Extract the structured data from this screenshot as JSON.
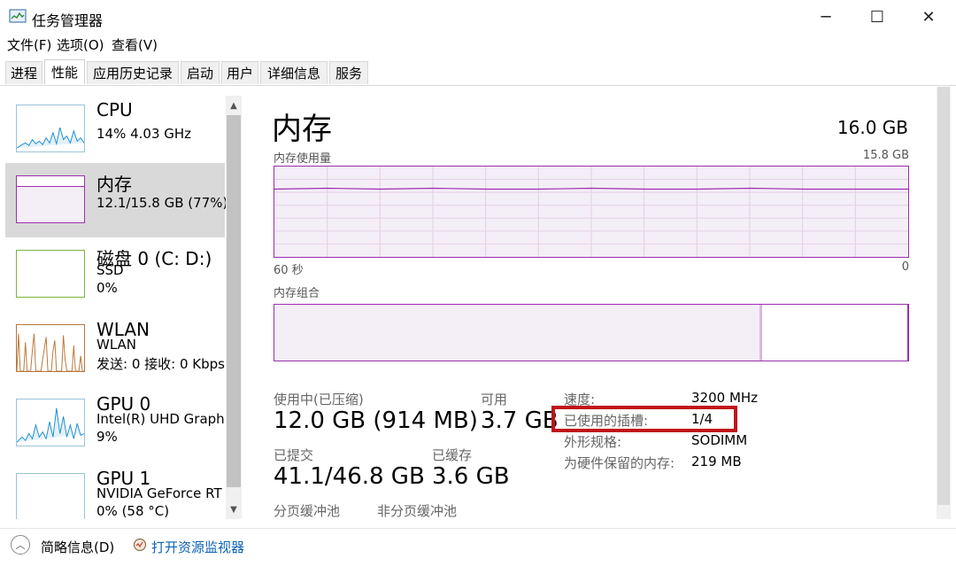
{
  "window": {
    "title": "任务管理器",
    "minimize": "─",
    "maximize": "☐",
    "close": "✕"
  },
  "menu": [
    "文件(F)",
    "选项(O)",
    "查看(V)"
  ],
  "tabs": [
    "进程",
    "性能",
    "应用历史记录",
    "启动",
    "用户",
    "详细信息",
    "服务"
  ],
  "sidebar": {
    "items": [
      {
        "title": "CPU",
        "sub1": "14% 4.03 GHz"
      },
      {
        "title": "内存",
        "sub1": "12.1/15.8 GB (77%)"
      },
      {
        "title": "磁盘 0 (C: D:)",
        "sub1": "SSD",
        "sub2": "0%"
      },
      {
        "title": "WLAN",
        "sub1": "WLAN",
        "sub2": "发送: 0 接收: 0 Kbps"
      },
      {
        "title": "GPU 0",
        "sub1": "Intel(R) UHD Graph",
        "sub2": "9%"
      },
      {
        "title": "GPU 1",
        "sub1": "NVIDIA GeForce RT",
        "sub2": "0% (58 °C)"
      }
    ]
  },
  "main": {
    "title": "内存",
    "total": "16.0 GB",
    "usage_label": "内存使用量",
    "usage_max": "15.8 GB",
    "time_left": "60 秒",
    "time_right": "0",
    "composition_label": "内存组合",
    "in_use_fraction": 0.77
  },
  "stats": {
    "in_use_label": "使用中(已压缩)",
    "in_use_value": "12.0 GB (914 MB)",
    "available_label": "可用",
    "available_value": "3.7 GB",
    "committed_label": "已提交",
    "committed_value": "41.1/46.8 GB",
    "cached_label": "已缓存",
    "cached_value": "3.6 GB",
    "paged_label": "分页缓冲池",
    "nonpaged_label": "非分页缓冲池"
  },
  "details": [
    {
      "label": "速度:",
      "value": "3200 MHz"
    },
    {
      "label": "已使用的插槽:",
      "value": "1/4"
    },
    {
      "label": "外形规格:",
      "value": "SODIMM"
    },
    {
      "label": "为硬件保留的内存:",
      "value": "219 MB"
    }
  ],
  "footer": {
    "fewer_details": "简略信息(D)",
    "resource_monitor": "打开资源监视器"
  },
  "colors": {
    "memory": "#9b2fae",
    "cpu": "#1d8fd1",
    "wlan": "#b9773a",
    "highlight": "#c0141a",
    "link": "#0b63b6"
  }
}
